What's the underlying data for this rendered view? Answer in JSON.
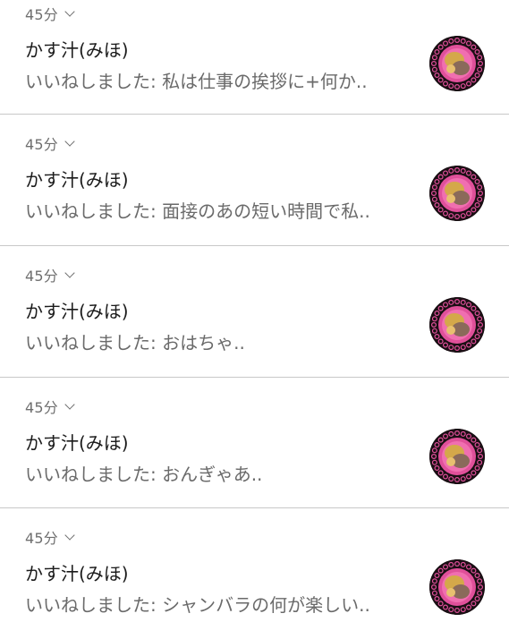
{
  "notifications": [
    {
      "time": "45分",
      "name": "かす汁(みほ)",
      "message": "いいねしました: 私は仕事の挨拶に+何か.."
    },
    {
      "time": "45分",
      "name": "かす汁(みほ)",
      "message": "いいねしました: 面接のあの短い時間で私.."
    },
    {
      "time": "45分",
      "name": "かす汁(みほ)",
      "message": "いいねしました: おはちゃ.."
    },
    {
      "time": "45分",
      "name": "かす汁(みほ)",
      "message": "いいねしました: おんぎゃあ.."
    },
    {
      "time": "45分",
      "name": "かす汁(みほ)",
      "message": "いいねしました: シャンバラの何が楽しい.."
    }
  ],
  "colors": {
    "time_text": "#6f6f6f",
    "name_text": "#1b1b1b",
    "message_text": "#6a6a6a",
    "divider": "#c8c8c8",
    "avatar_ring": "#e0509a",
    "avatar_center": "#d4a84a"
  }
}
